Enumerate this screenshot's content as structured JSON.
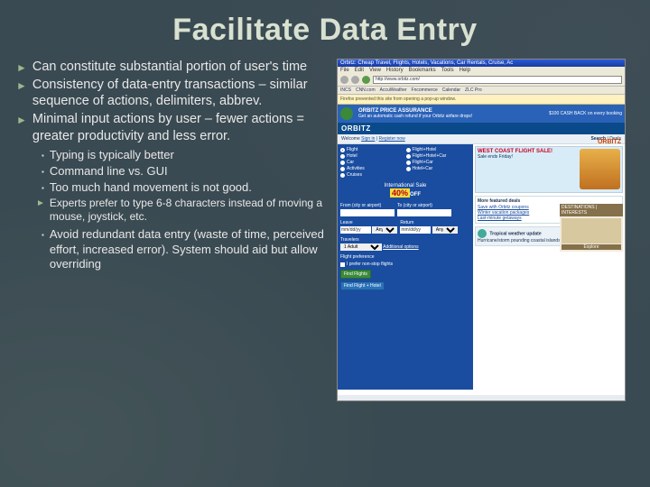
{
  "title": "Facilitate Data Entry",
  "bullets": [
    "Can constitute substantial portion of user's time",
    "Consistency of data-entry transactions – similar sequence of actions, delimiters, abbrev.",
    "Minimal input actions by user – fewer actions = greater productivity and less error."
  ],
  "sub_bullets": [
    "Typing is typically better",
    "Command line vs. GUI",
    "Too much hand movement is not good."
  ],
  "sub_sub": "Experts prefer to type 6-8 characters instead of moving a mouse, joystick, etc.",
  "sub_bullet_4": "Avoid redundant data entry (waste of time, perceived effort, increased error). System should aid but allow overriding",
  "browser": {
    "title": "Orbitz: Cheap Travel, Flights, Hotels, Vacations, Car Rentals, Cruise, Ac",
    "menu": [
      "File",
      "Edit",
      "View",
      "History",
      "Bookmarks",
      "Tools",
      "Help"
    ],
    "address": "http://www.orbitz.com/",
    "bookmarks": [
      "INCS",
      "CNN.com",
      "AccuWeather",
      "Fncommerce",
      "Calendar",
      "ZLC Pro"
    ],
    "notice": "Firefox prevented this site from opening a pop-up window.",
    "promo_title": "ORBITZ PRICE ASSURANCE",
    "promo_sub": "Get an automatic cash refund if your Orbitz airfare drops!",
    "promo_badge": "$100 CASH BACK on every booking",
    "logo": "ORBITZ",
    "orbitz2": "ORBITZ",
    "welcome": "Welcome",
    "signin": "Sign in",
    "register": "Register now",
    "nav": [
      "Search",
      "Deals"
    ],
    "search_tabs": {
      "left": [
        "Flight",
        "Hotel",
        "Car",
        "Activities",
        "Cruises"
      ],
      "right": [
        "Flight+Hotel",
        "Flight+Hotel+Car",
        "Flight+Car",
        "Hotel+Car"
      ]
    },
    "intl_label": "International Sale",
    "intl_pct": "40%",
    "intl_off": "OFF",
    "form": {
      "from_lbl": "From (city or airport)",
      "from_val": "",
      "to_lbl": "To (city or airport)",
      "to_val": "",
      "leave_lbl": "Leave",
      "leave_val": "mm/dd/yy",
      "return_lbl": "Return",
      "return_val": "mm/dd/yy",
      "time": "Anytime",
      "travelers_lbl": "Travelers",
      "travelers_val": "1 Adult",
      "additional": "Additional options",
      "pref_lbl": "Flight preference",
      "pref_check": "I prefer non-stop flights",
      "btn1": "Find Flights",
      "btn2": "Find Flight + Hotel"
    },
    "ad": {
      "headline": "WEST COAST FLIGHT SALE!",
      "sub": "Sale ends Friday!"
    },
    "more": {
      "heading": "More featured deals",
      "items": [
        "Save with Orbitz coupons",
        "Winter vacation packages",
        "Last-minute getaways"
      ]
    },
    "dest": {
      "heading": "DESTINATIONS | INTERESTS",
      "explore": "Explore"
    },
    "weather": {
      "heading": "Tropical weather update",
      "body": "Hurricane/storm pounding coastal islands in Texas"
    }
  }
}
